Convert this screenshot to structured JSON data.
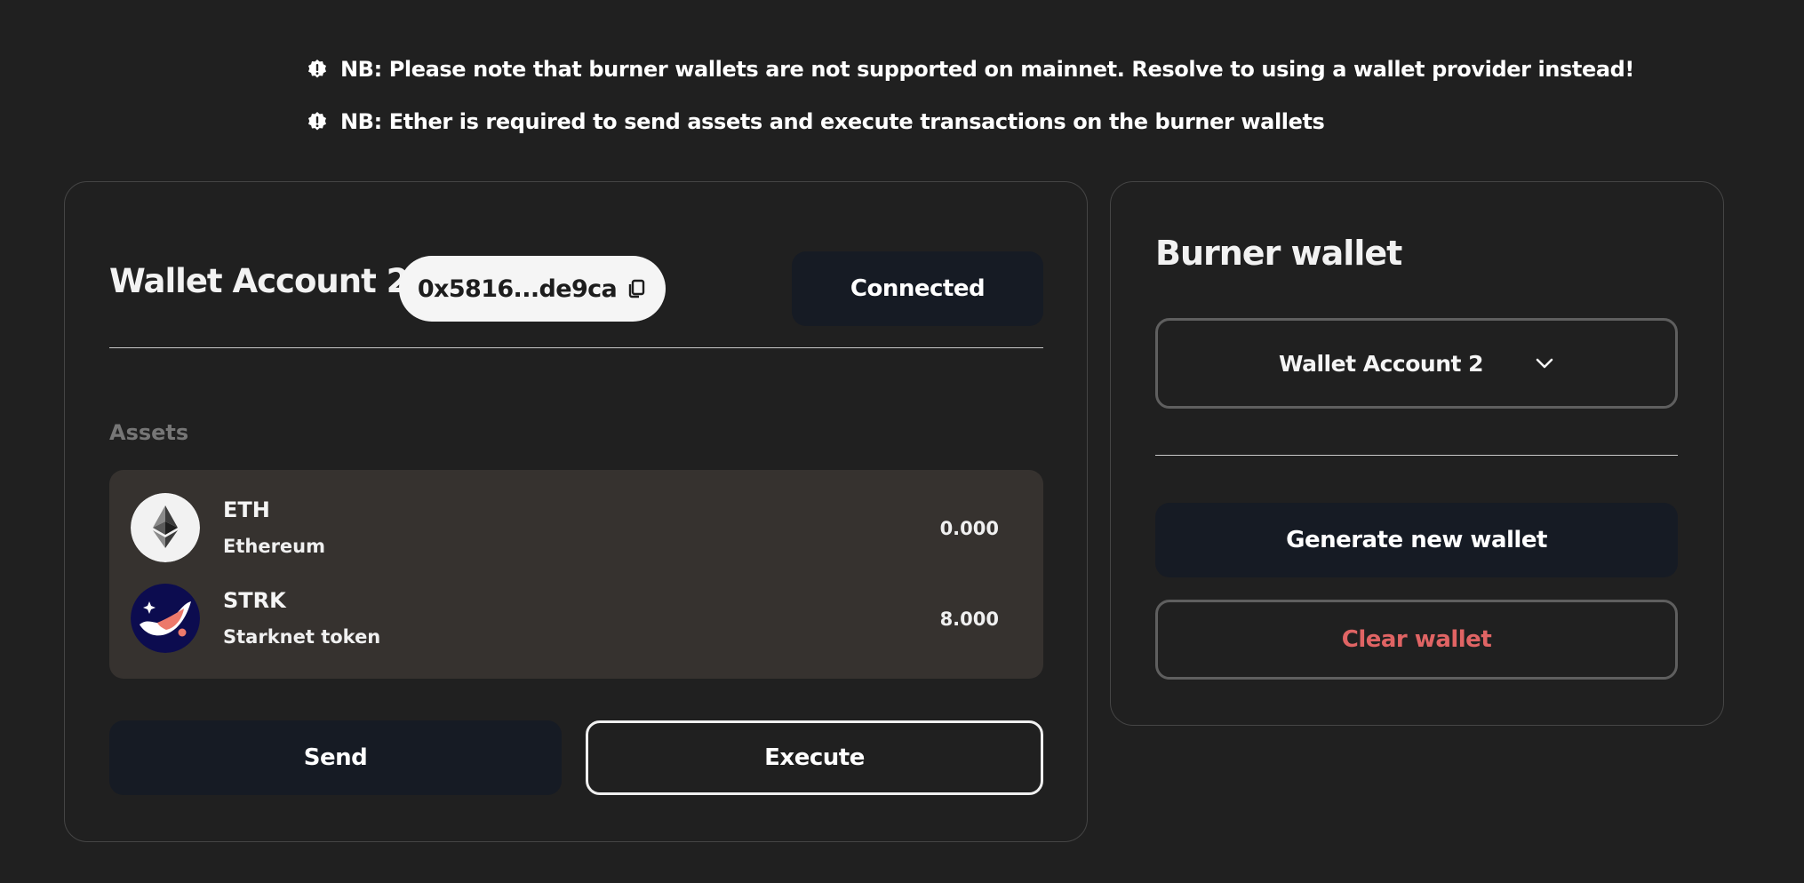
{
  "notices": [
    "NB: Please note that burner wallets are not supported on mainnet. Resolve to using a wallet provider instead!",
    "NB: Ether is required to send assets and execute transactions on the burner wallets"
  ],
  "wallet": {
    "title": "Wallet Account 2",
    "address": "0x5816...de9ca",
    "status": "Connected",
    "assets_label": "Assets",
    "assets": [
      {
        "symbol": "ETH",
        "name": "Ethereum",
        "balance": "0.000",
        "icon": "ethereum-logo"
      },
      {
        "symbol": "STRK",
        "name": "Starknet token",
        "balance": "8.000",
        "icon": "starknet-logo"
      }
    ],
    "send_label": "Send",
    "execute_label": "Execute"
  },
  "burner": {
    "title": "Burner wallet",
    "selected_account": "Wallet Account 2",
    "generate_label": "Generate new wallet",
    "clear_label": "Clear wallet"
  },
  "colors": {
    "background": "#202020",
    "button_dark": "#161b24",
    "assets_panel": "#36322f",
    "danger": "#e06464"
  }
}
